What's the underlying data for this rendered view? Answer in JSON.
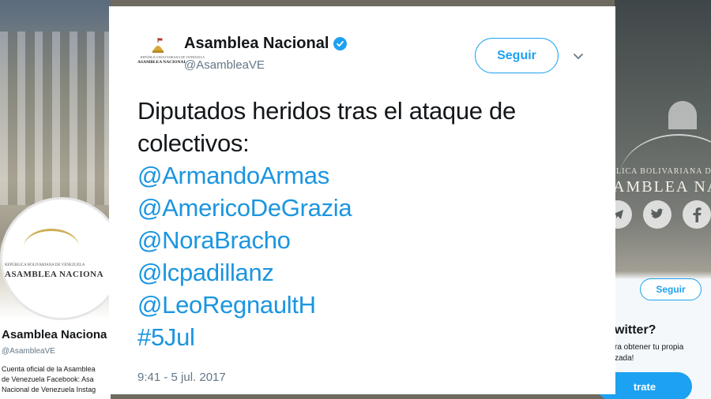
{
  "background": {
    "left_profile": {
      "seal_subtitle": "REPÚBLICA BOLIVARIANA DE VENEZUELA",
      "seal_title": "ASAMBLEA NACIONA",
      "name": "Asamblea Naciona",
      "handle": "@AsambleaVE",
      "bio_lines": [
        "Cuenta oficial de la Asamblea",
        "de Venezuela Facebook: Asa",
        "Nacional de Venezuela Instag"
      ]
    },
    "right_profile": {
      "banner_subtitle": "LICA BOLIVARIANA D",
      "banner_title": "AMBLEA NA",
      "follow_label": "Seguir",
      "question": "witter?",
      "text_lines": [
        "ra obtener tu propia",
        "zada!"
      ],
      "signup_label": "trate",
      "social_icons": [
        "telegram-icon",
        "twitter-icon",
        "facebook-icon"
      ]
    }
  },
  "tweet": {
    "author": {
      "name": "Asamblea Nacional",
      "handle": "@AsambleaVE",
      "verified": true,
      "avatar_text_small": "REPÚBLICA BOLIVARIANA DE VENEZUELA",
      "avatar_text": "ASAMBLEA NACIONAL"
    },
    "follow_label": "Seguir",
    "text_lines": [
      "Diputados heridos tras el ataque de",
      "colectivos:"
    ],
    "mentions": [
      "@ArmandoArmas",
      "@AmericoDeGrazia",
      "@NoraBracho",
      "@lcpadillanz",
      "@LeoRegnaultH"
    ],
    "hashtag": "#5Jul",
    "timestamp": "9:41 - 5 jul. 2017"
  },
  "colors": {
    "accent": "#1da1f2",
    "link": "#1b95e0",
    "text": "#14171a",
    "secondary": "#657786"
  }
}
